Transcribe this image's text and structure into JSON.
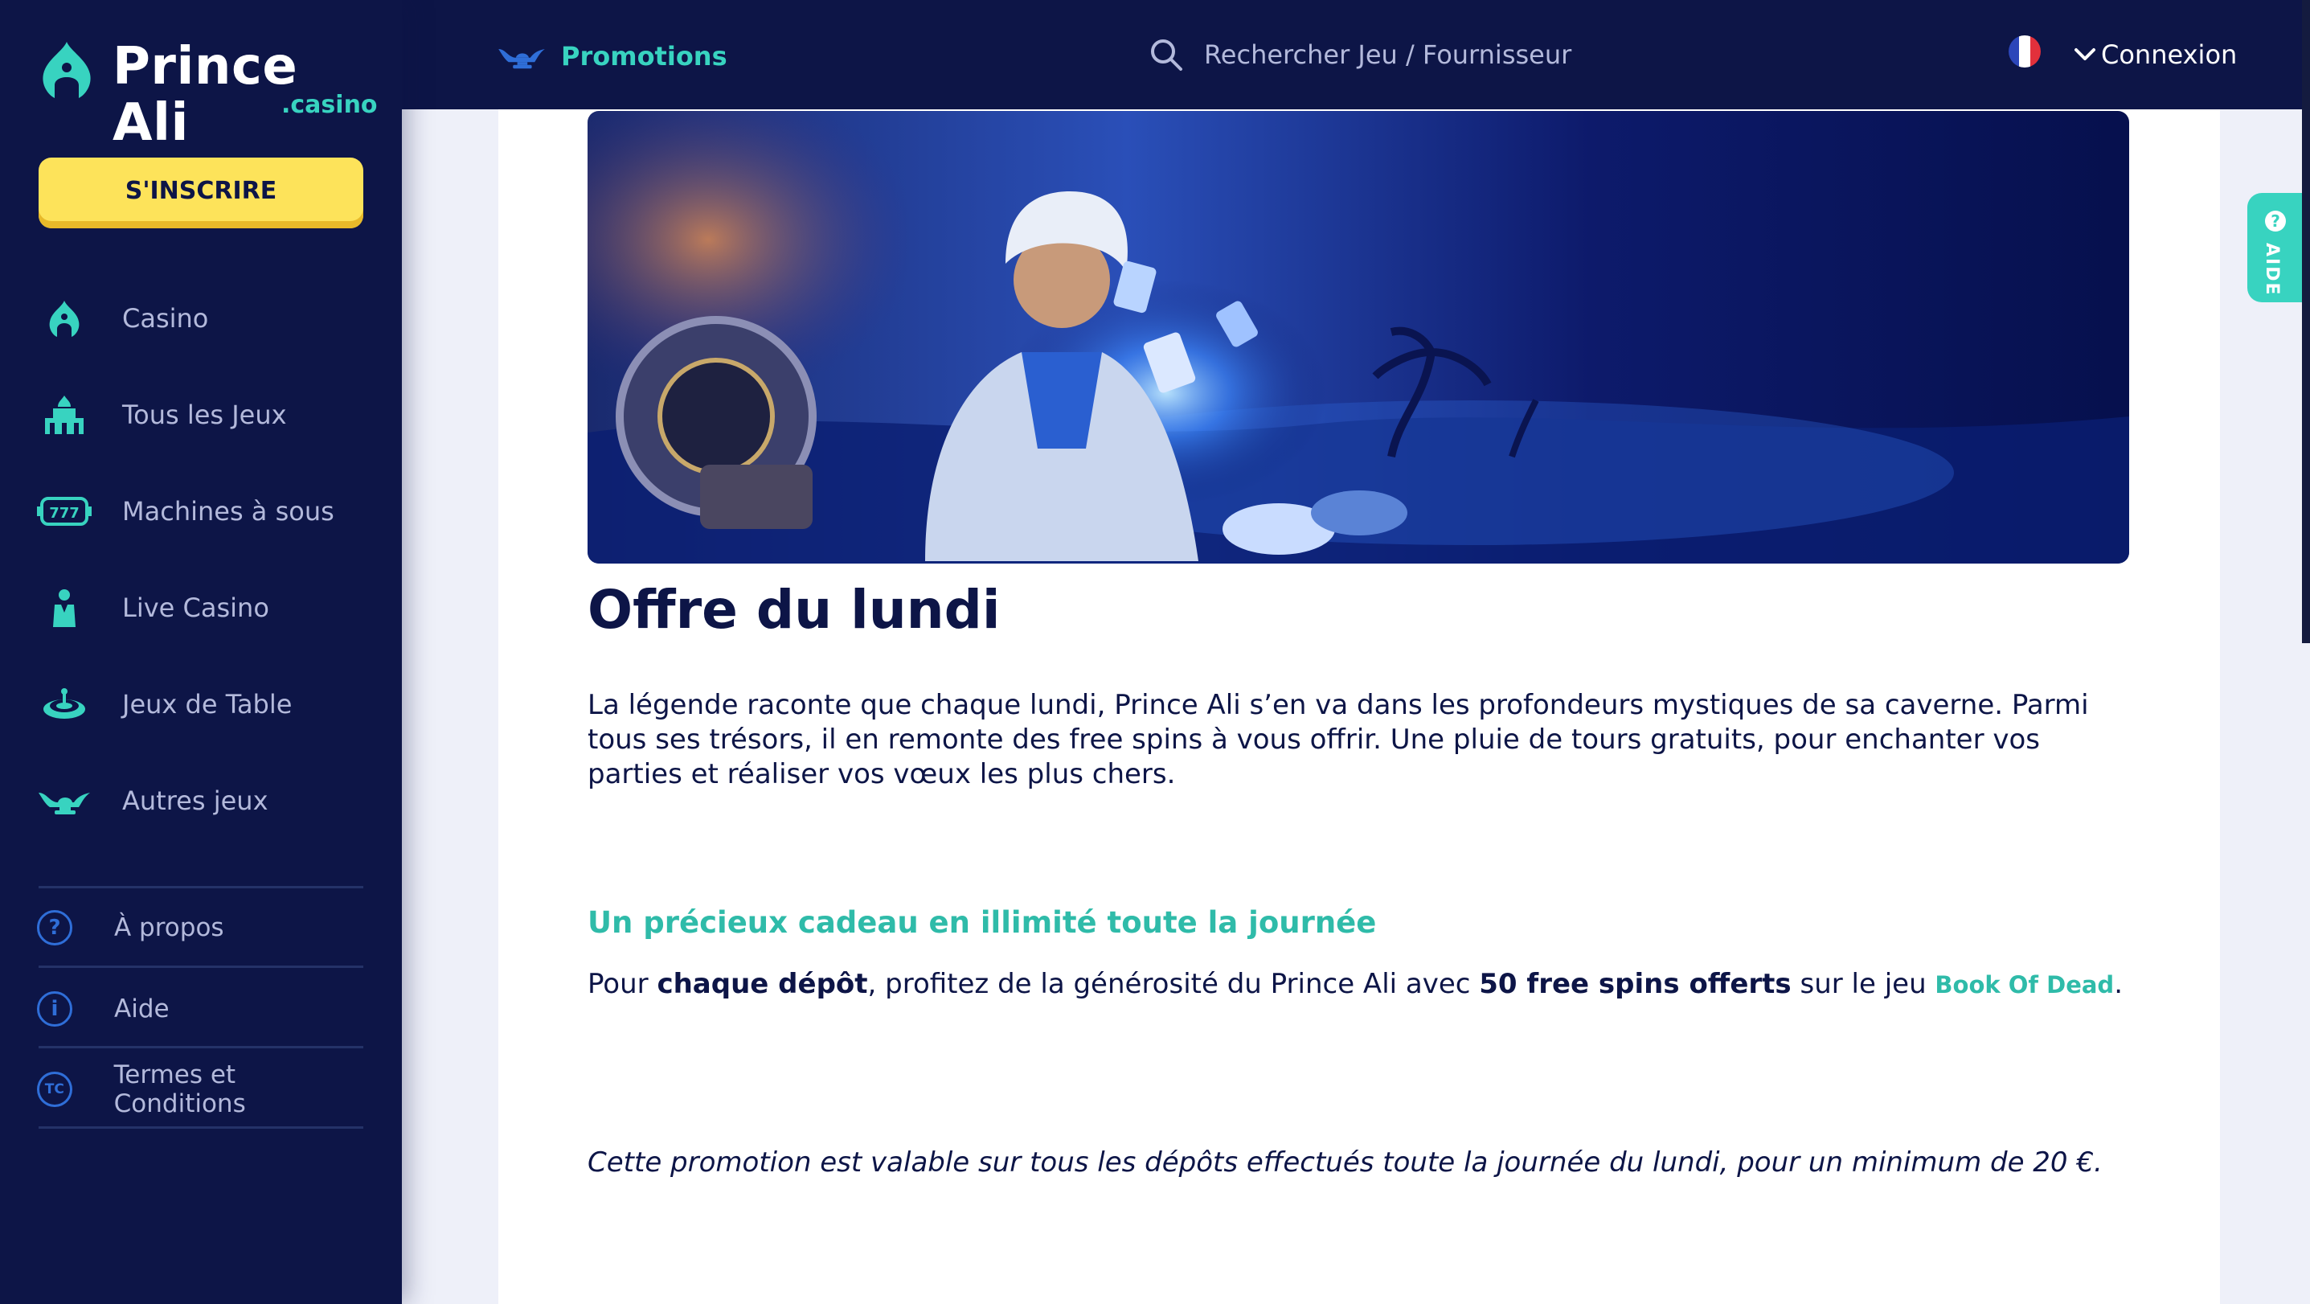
{
  "brand": {
    "name": "Prince Ali",
    "sub": ".casino",
    "accent": "#38d3c0",
    "navy": "#0d1547",
    "yellow": "#fde35a"
  },
  "sidebar": {
    "signup_label": "S'INSCRIRE",
    "items": [
      {
        "label": "Casino",
        "icon": "turban-icon"
      },
      {
        "label": "Tous les Jeux",
        "icon": "palace-icon"
      },
      {
        "label": "Machines à sous",
        "icon": "slot-machine-icon"
      },
      {
        "label": "Live Casino",
        "icon": "dealer-icon"
      },
      {
        "label": "Jeux de Table",
        "icon": "roulette-table-icon"
      },
      {
        "label": "Autres jeux",
        "icon": "magic-lamp-icon"
      }
    ],
    "links": [
      {
        "label": "À propos",
        "icon_glyph": "?"
      },
      {
        "label": "Aide",
        "icon_glyph": "i"
      },
      {
        "label": "Termes et Conditions",
        "icon_glyph": "TC"
      }
    ]
  },
  "header": {
    "promotions_label": "Promotions",
    "search_placeholder": "Rechercher Jeu / Fournisseur",
    "login_label": "Connexion",
    "language": "fr"
  },
  "main": {
    "title": "Offre du lundi",
    "intro": "La légende raconte que chaque lundi, Prince Ali s’en va dans les profondeurs mystiques de sa caverne. Parmi tous ses trésors, il en remonte des free spins à vous offrir. Une pluie de tours gratuits, pour enchanter vos parties et réaliser vos vœux les plus chers.",
    "subheading": "Un précieux cadeau en illimité toute la journée",
    "body": {
      "p1": "Pour ",
      "b1": "chaque dépôt",
      "p2": ", profitez de la générosité du Prince Ali avec ",
      "b2": "50 free spins offerts",
      "p3": " sur le jeu ",
      "game_link": "Book Of Dead",
      "p4": "."
    },
    "note": "Cette promotion est valable sur tous les dépôts effectués toute la journée du lundi, pour un minimum de 20 €."
  },
  "help_tab": {
    "label": "AIDE"
  }
}
